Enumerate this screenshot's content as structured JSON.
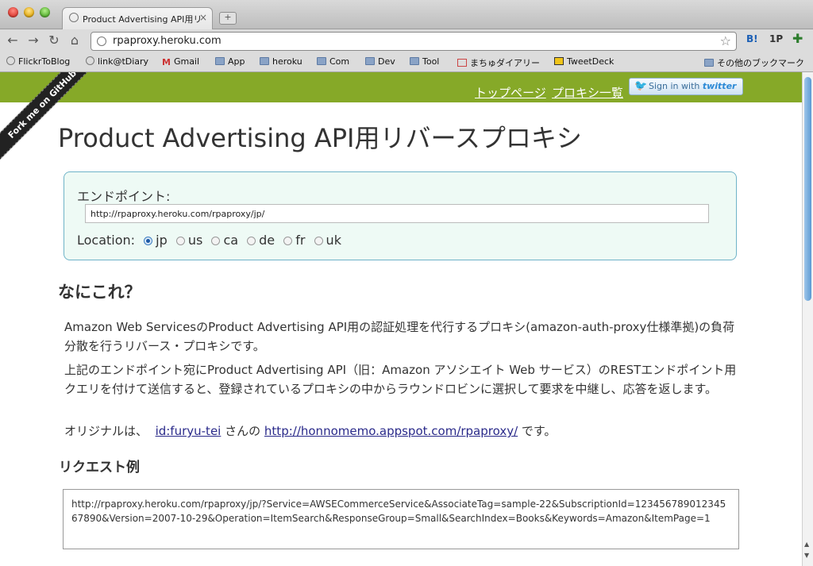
{
  "browser": {
    "tab_title": "Product Advertising API用リバ",
    "tab_close": "×",
    "new_tab": "+",
    "url": "rpaproxy.heroku.com",
    "ext_hatena": "B!",
    "ext_1p": "1P",
    "nav_back": "←",
    "nav_forward": "→",
    "nav_reload": "↻",
    "nav_home": "⌂",
    "star": "☆"
  },
  "bookmarks": [
    {
      "label": "FlickrToBlog",
      "icon": "globe-icon"
    },
    {
      "label": "link@tDiary",
      "icon": "globe-icon"
    },
    {
      "label": "Gmail",
      "icon": "gmail-icon",
      "glyph": "M"
    },
    {
      "label": "App",
      "icon": "folder-icon"
    },
    {
      "label": "heroku",
      "icon": "folder-icon"
    },
    {
      "label": "Com",
      "icon": "folder-icon"
    },
    {
      "label": "Dev",
      "icon": "folder-icon"
    },
    {
      "label": "Tool",
      "icon": "folder-icon"
    },
    {
      "label": "まちゅダイアリー",
      "icon": "diary-icon"
    },
    {
      "label": "TweetDeck",
      "icon": "tweetdeck-icon"
    }
  ],
  "bookmarks_other": "その他のブックマーク",
  "header": {
    "link_top": "トップページ",
    "link_proxies": "プロキシ一覧",
    "twitter_signin": "Sign in with",
    "twitter_brand": "twitter"
  },
  "ribbon": "Fork me on GitHub",
  "page_title": "Product Advertising API用リバースプロキシ",
  "endpoint": {
    "label": "エンドポイント:",
    "value": "http://rpaproxy.heroku.com/rpaproxy/jp/",
    "location_label": "Location:",
    "options": [
      {
        "label": "jp",
        "selected": true
      },
      {
        "label": "us",
        "selected": false
      },
      {
        "label": "ca",
        "selected": false
      },
      {
        "label": "de",
        "selected": false
      },
      {
        "label": "fr",
        "selected": false
      },
      {
        "label": "uk",
        "selected": false
      }
    ]
  },
  "what_heading": "なにこれ？",
  "para1": "Amazon Web ServicesのProduct Advertising API用の認証処理を代行するプロキシ(amazon-auth-proxy仕様準拠)の負荷分散を行うリバース・プロキシです。",
  "para2": "上記のエンドポイント宛にProduct Advertising API（旧：Amazon アソシエイト Web サービス）のRESTエンドポイント用クエリを付けて送信すると、登録されているプロキシの中からラウンドロビンに選択して要求を中継し、応答を返します。",
  "para3": {
    "prefix": "オリジナルは、",
    "author_link": "id:furyu-tei",
    "middle": "さんの",
    "original_link": "http://honnomemo.appspot.com/rpaproxy/",
    "suffix": "です。"
  },
  "request_heading": "リクエスト例",
  "request_example": "http://rpaproxy.heroku.com/rpaproxy/jp/?Service=AWSECommerceService&AssociateTag=sample-22&SubscriptionId=12345678901234567890&Version=2007-10-29&Operation=ItemSearch&ResponseGroup=Small&SearchIndex=Books&Keywords=Amazon&ItemPage=1"
}
